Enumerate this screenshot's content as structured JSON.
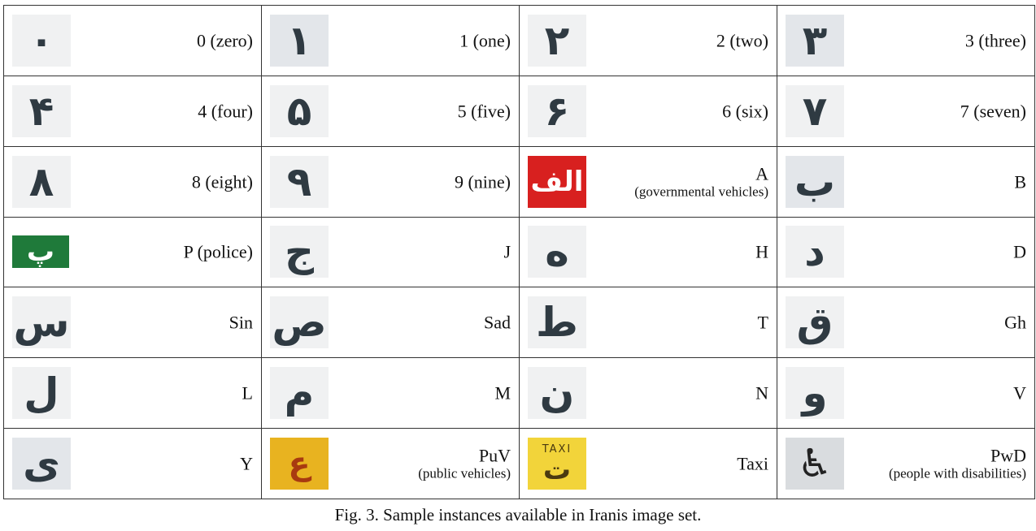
{
  "caption": "Fig. 3. Sample instances available in Iranis image set.",
  "cells": [
    {
      "glyph": "٠",
      "label": "0 (zero)",
      "sub": ""
    },
    {
      "glyph": "١",
      "label": "1 (one)",
      "sub": ""
    },
    {
      "glyph": "٢",
      "label": "2 (two)",
      "sub": ""
    },
    {
      "glyph": "٣",
      "label": "3 (three)",
      "sub": ""
    },
    {
      "glyph": "۴",
      "label": "4 (four)",
      "sub": ""
    },
    {
      "glyph": "۵",
      "label": "5 (five)",
      "sub": ""
    },
    {
      "glyph": "۶",
      "label": "6 (six)",
      "sub": ""
    },
    {
      "glyph": "٧",
      "label": "7 (seven)",
      "sub": ""
    },
    {
      "glyph": "٨",
      "label": "8 (eight)",
      "sub": ""
    },
    {
      "glyph": "٩",
      "label": "9 (nine)",
      "sub": ""
    },
    {
      "glyph": "الف",
      "label": "A",
      "sub": "(governmental vehicles)"
    },
    {
      "glyph": "ب",
      "label": "B",
      "sub": ""
    },
    {
      "glyph": "پ",
      "label": "P (police)",
      "sub": ""
    },
    {
      "glyph": "ج",
      "label": "J",
      "sub": ""
    },
    {
      "glyph": "ه",
      "label": "H",
      "sub": ""
    },
    {
      "glyph": "د",
      "label": "D",
      "sub": ""
    },
    {
      "glyph": "س",
      "label": "Sin",
      "sub": ""
    },
    {
      "glyph": "ص",
      "label": "Sad",
      "sub": ""
    },
    {
      "glyph": "ط",
      "label": "T",
      "sub": ""
    },
    {
      "glyph": "ق",
      "label": "Gh",
      "sub": ""
    },
    {
      "glyph": "ل",
      "label": "L",
      "sub": ""
    },
    {
      "glyph": "م",
      "label": "M",
      "sub": ""
    },
    {
      "glyph": "ن",
      "label": "N",
      "sub": ""
    },
    {
      "glyph": "و",
      "label": "V",
      "sub": ""
    },
    {
      "glyph": "ی",
      "label": "Y",
      "sub": ""
    },
    {
      "glyph": "ع",
      "label": "PuV",
      "sub": "(public vehicles)"
    },
    {
      "glyph": "ت",
      "taxi_text": "TAXI",
      "label": "Taxi",
      "sub": ""
    },
    {
      "glyph": "♿",
      "label": "PwD",
      "sub": "(people with disabilities)"
    }
  ]
}
